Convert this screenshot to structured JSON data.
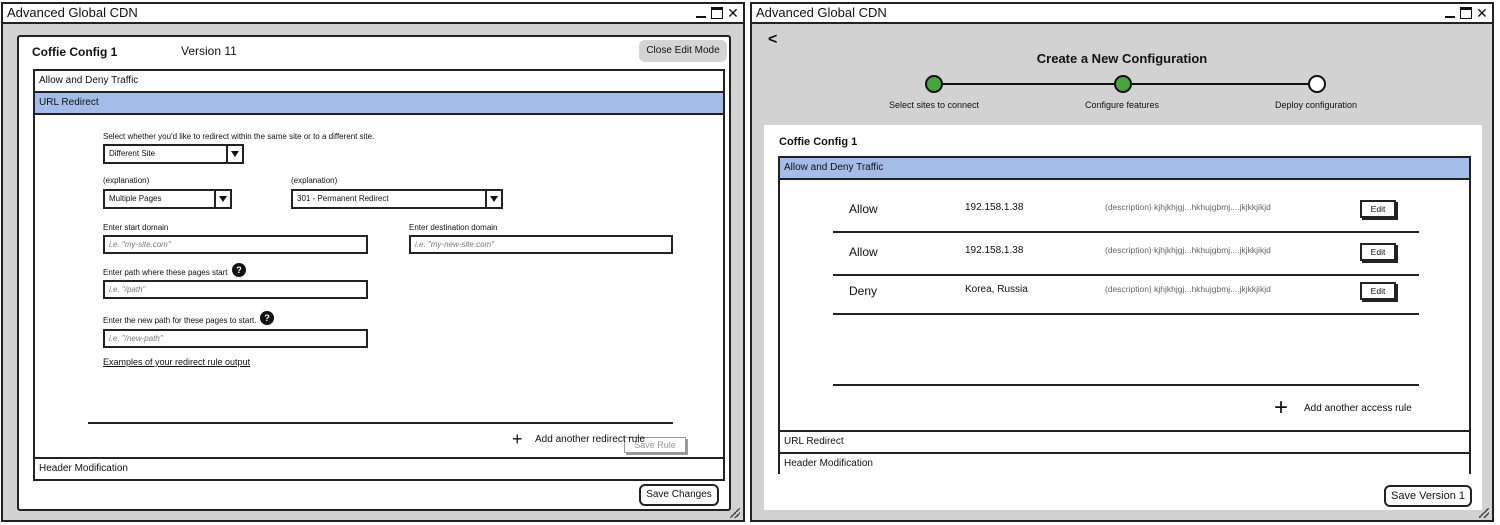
{
  "left_window": {
    "title": "Advanced Global CDN",
    "config_name": "Coffie Config 1",
    "version": "Version 11",
    "close_edit_label": "Close Edit Mode",
    "sections": [
      "Allow and Deny Traffic",
      "URL Redirect",
      "Header Modification"
    ],
    "redirect": {
      "intro": "Select whether you'd like to redirect within the same site or to a different site.",
      "site_type": "Different Site",
      "explanation1": "(explanation)",
      "pages_type": "Multiple Pages",
      "explanation2": "(explanation)",
      "redirect_type": "301 - Permanent Redirect",
      "start_domain_label": "Enter start domain",
      "start_domain_placeholder": "i.e. \"my-site.com\"",
      "dest_domain_label": "Enter destination domain",
      "dest_domain_placeholder": "i.e. \"my-new-site.com\"",
      "path_label": "Enter path where these pages start",
      "path_placeholder": "i.e. \"/path\"",
      "new_path_label": "Enter the new path for these pages to start.",
      "new_path_placeholder": "i.e. \"/new-path\"",
      "examples_link": "Examples of your redirect rule output",
      "save_rule": "Save Rule",
      "add_rule": "Add another redirect rule"
    },
    "save_changes": "Save Changes"
  },
  "right_window": {
    "title": "Advanced Global CDN",
    "back": "<",
    "wizard_title": "Create a New Configuration",
    "steps": [
      {
        "label": "Select sites to connect",
        "status": "done"
      },
      {
        "label": "Configure features",
        "status": "done"
      },
      {
        "label": "Deploy configuration",
        "status": "todo"
      }
    ],
    "config_name": "Coffie Config 1",
    "sections": [
      "Allow and Deny Traffic",
      "URL Redirect",
      "Header Modification"
    ],
    "rules": [
      {
        "action": "Allow",
        "target": "192.158.1.38",
        "description": "(description) kjhjkhjgj...hkhujgbmj....jkjkkjikjd",
        "edit": "Edit"
      },
      {
        "action": "Allow",
        "target": "192.158.1.38",
        "description": "(description) kjhjkhjgj...hkhujgbmj....jkjkkjikjd",
        "edit": "Edit"
      },
      {
        "action": "Deny",
        "target": "Korea, Russia",
        "description": "(description) kjhjkhjgj...hkhujgbmj....jkjkkjikjd",
        "edit": "Edit"
      }
    ],
    "add_rule": "Add another access rule",
    "save_version": "Save Version 1"
  },
  "colors": {
    "selected_section": "#a4bce9",
    "step_done": "#4aa43d"
  }
}
